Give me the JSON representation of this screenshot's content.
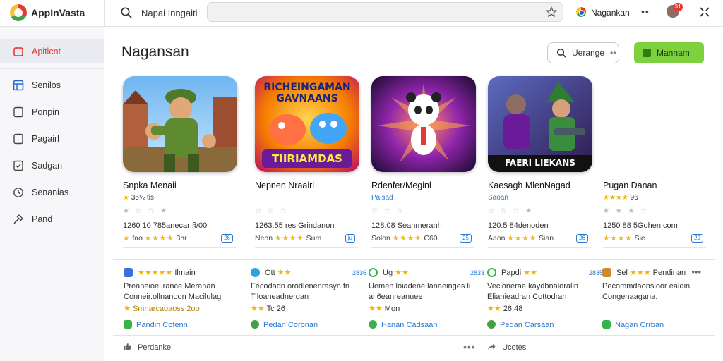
{
  "app": {
    "brand": "AppInVasta"
  },
  "topbar": {
    "search_label": "Napai Inngaiti",
    "search_value": "",
    "account_label": "Nagankan",
    "notification_count": "31"
  },
  "sidebar": {
    "items": [
      {
        "label": "Apiticnt",
        "icon": "calendar-icon",
        "active": true
      },
      {
        "label": "Senilos",
        "icon": "grid-icon",
        "active": false
      },
      {
        "label": "Ponpin",
        "icon": "square-icon",
        "active": false
      },
      {
        "label": "Pagairl",
        "icon": "square-icon",
        "active": false
      },
      {
        "label": "Sadgan",
        "icon": "check-square-icon",
        "active": false
      },
      {
        "label": "Senanias",
        "icon": "clock-icon",
        "active": false
      },
      {
        "label": "Pand",
        "icon": "gavel-icon",
        "active": false
      }
    ]
  },
  "main": {
    "title": "Nagansan",
    "upgrade_label": "Uerange",
    "green_button_label": "Mannam",
    "apps": [
      {
        "name": "Snpka Menaii",
        "sub": "35½ tis",
        "sub_star": "★",
        "info": "1260 10 785anecar §/00",
        "rating_label": "fao",
        "rating_stars": "★★★★",
        "rating_value": "3hr",
        "tag": "26"
      },
      {
        "name": "Nepnen Nraairl",
        "sub": "",
        "sub_star": "",
        "info": "1263.55 res Grindanon",
        "rating_label": "Neon",
        "rating_stars": "★★★★",
        "rating_value": "Sum",
        "tag": "ju",
        "art_title": "RICHEINGAMAN GAVNAANS",
        "art_footer": "TIIRIAMDAS"
      },
      {
        "name": "Rdenfer/Meginl",
        "sub": "Paisad",
        "sub_star": "",
        "info": "128.08 Seanmeranh",
        "rating_label": "Solon",
        "rating_stars": "★★★★",
        "rating_value": "C60",
        "tag": "25"
      },
      {
        "name": "Kaesagh MlenNagad",
        "sub": "Saoan",
        "sub_star": "",
        "info": "120.5 84denoden",
        "rating_label": "Aaon",
        "rating_stars": "★★★★",
        "rating_value": "Sian",
        "tag": "26",
        "art_footer": "FAERI LIEKANS"
      },
      {
        "name": "Pugan Danan",
        "sub": "96",
        "sub_star": "★★★★",
        "info": "1250 88 5Gohen.com",
        "rating_label": "",
        "rating_stars": "★★★★",
        "rating_value": "Sie",
        "tag": "29"
      }
    ],
    "reviews": [
      {
        "head": "Ilmain",
        "head_stars": "★★★★★",
        "num": "",
        "line1": "Preaneioe lrance Meranan",
        "line2": "Conneir.ollnanoon Macilulag",
        "line3": "Smnarcaoaoss 2oo",
        "line3_star": "★",
        "footer": "Pandin Cofenn",
        "icon_color": "#3a6fe0"
      },
      {
        "head": "Ott",
        "head_stars": "★★",
        "num": "2836",
        "line1": "Fecodadn orodlenenrasyn fn",
        "line2": "Tiloaneadnerdan",
        "line3": "Tc 26",
        "line3_star": "★★",
        "footer": "Pedan Corbnan",
        "icon_color": "#2aa5e0"
      },
      {
        "head": "Ug",
        "head_stars": "★★",
        "num": "2833",
        "line1": "Uemen loiadene lanaeinges li",
        "line2": "al 6eanreanuee",
        "line3": "Mon",
        "line3_star": "★★",
        "footer": "Hanan Cadsaan",
        "icon_color": "#38b24a"
      },
      {
        "head": "Papdi",
        "head_stars": "★★",
        "num": "2835",
        "line1": "Vecionerae kaydbnaloralin",
        "line2": "Elianieadran Cottodran",
        "line3": "26 48",
        "line3_star": "★★",
        "footer": "Pedan Carsaan",
        "icon_color": "#38b24a"
      },
      {
        "head": "Sel",
        "head_stars": "★★★",
        "num": "Pendinan",
        "line1": "Pecommdaonsloor ealdin",
        "line2": "Congenaagana.",
        "line3": "",
        "line3_star": "",
        "footer": "Nagan Crrban",
        "icon_color": "#d08a2c"
      }
    ],
    "bottom_left": "Perdanke",
    "bottom_right": "Ucotes"
  }
}
